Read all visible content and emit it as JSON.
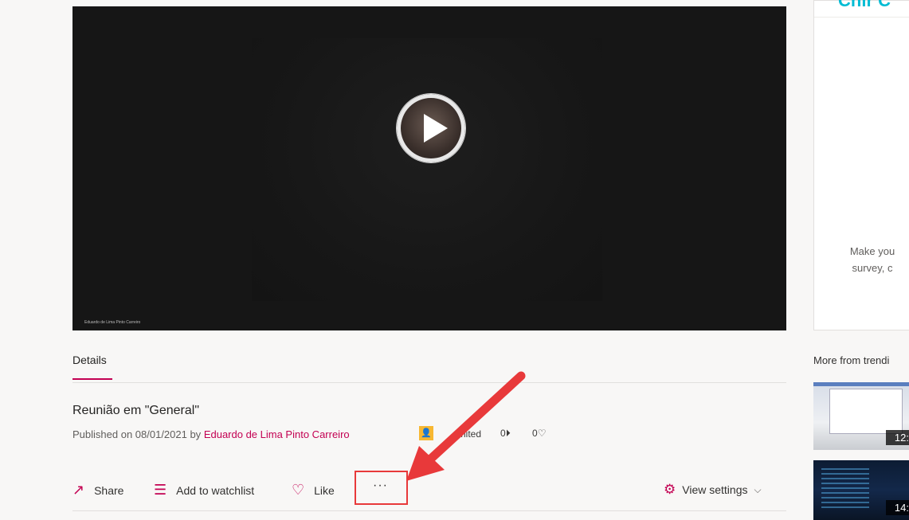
{
  "video": {
    "caption": "Eduardo de Lima Pinto Carreiro"
  },
  "tabs": {
    "details_label": "Details"
  },
  "meeting": {
    "title": "Reunião em \"General\"",
    "published_prefix": "Published on 08/01/2021 by ",
    "author": "Eduardo de Lima Pinto Carreiro",
    "visibility": "imited",
    "views": "0",
    "likes": "0"
  },
  "actions": {
    "share_label": "Share",
    "watchlist_label": "Add to watchlist",
    "like_label": "Like",
    "more_label": "···",
    "settings_label": "View settings"
  },
  "sidebar": {
    "header_partial": "Chir C",
    "promo_text_1": "Make you",
    "promo_text_2": "survey, c",
    "trending_heading": "More from trendi",
    "thumbnails": [
      {
        "duration": "12:"
      },
      {
        "duration": "14:"
      }
    ]
  },
  "colors": {
    "accent": "#c30052",
    "annotation": "#e8393a",
    "header_teal": "#00bcd4"
  }
}
